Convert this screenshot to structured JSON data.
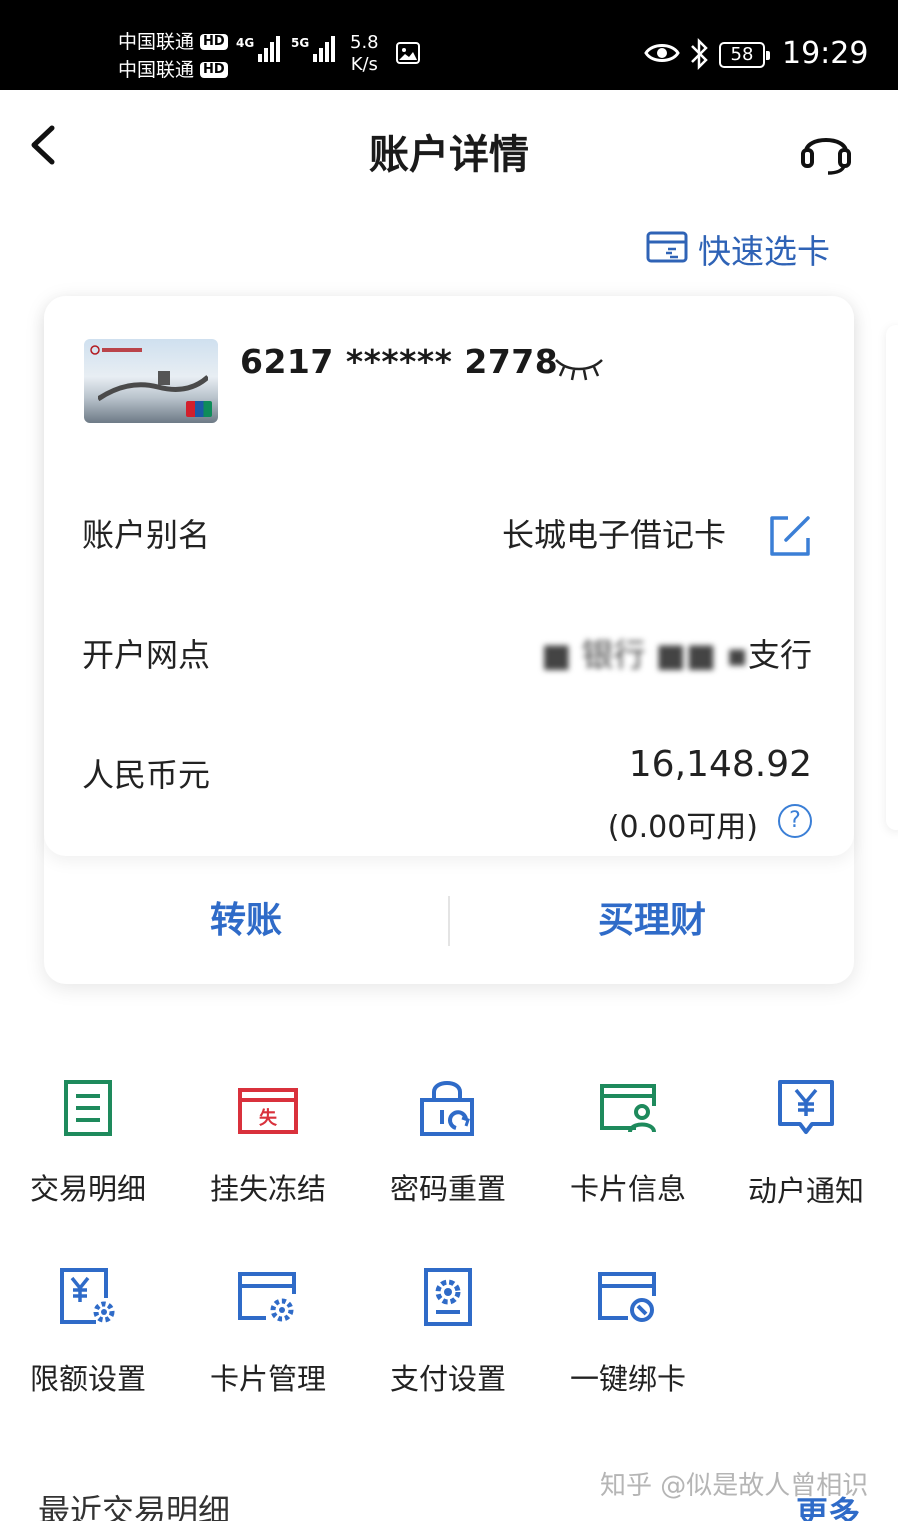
{
  "status_bar": {
    "carrier_1": "中国联通",
    "carrier_2": "中国联通",
    "hd_badge": "HD",
    "network_1": "4G",
    "network_2": "5G",
    "speed_value": "5.8",
    "speed_unit": "K/s",
    "battery": "58",
    "time": "19:29"
  },
  "header": {
    "title": "账户详情"
  },
  "quick_select": {
    "label": "快速选卡"
  },
  "account": {
    "card_number": "6217 ****** 2778",
    "alias_label": "账户别名",
    "alias_value": "长城电子借记卡",
    "branch_label": "开户网点",
    "branch_value_blurred": "银行",
    "branch_value_suffix": "支行",
    "currency_label": "人民币元",
    "balance": "16,148.92",
    "available": "(0.00可用)",
    "help_symbol": "?"
  },
  "actions": {
    "transfer": "转账",
    "buy_wealth": "买理财"
  },
  "grid": {
    "items": [
      {
        "label": "交易明细",
        "icon": "document-list-icon",
        "color": "#1e8a5c"
      },
      {
        "label": "挂失冻结",
        "icon": "lost-card-icon",
        "color": "#d9313c"
      },
      {
        "label": "密码重置",
        "icon": "lock-reset-icon",
        "color": "#2f6bc8"
      },
      {
        "label": "卡片信息",
        "icon": "card-info-icon",
        "color": "#1e8a5c"
      },
      {
        "label": "动户通知",
        "icon": "yuan-notice-icon",
        "color": "#2f6bc8"
      },
      {
        "label": "限额设置",
        "icon": "limit-settings-icon",
        "color": "#2f6bc8"
      },
      {
        "label": "卡片管理",
        "icon": "card-manage-icon",
        "color": "#2f6bc8"
      },
      {
        "label": "支付设置",
        "icon": "pay-settings-icon",
        "color": "#2f6bc8"
      },
      {
        "label": "一键绑卡",
        "icon": "bind-card-icon",
        "color": "#2f6bc8"
      }
    ]
  },
  "recent": {
    "title": "最近交易明细",
    "more": "更多"
  },
  "watermark": "知乎 @似是故人曾相识",
  "colors": {
    "accent_blue": "#2f6bc8",
    "green": "#1e8a5c",
    "red": "#d9313c"
  }
}
